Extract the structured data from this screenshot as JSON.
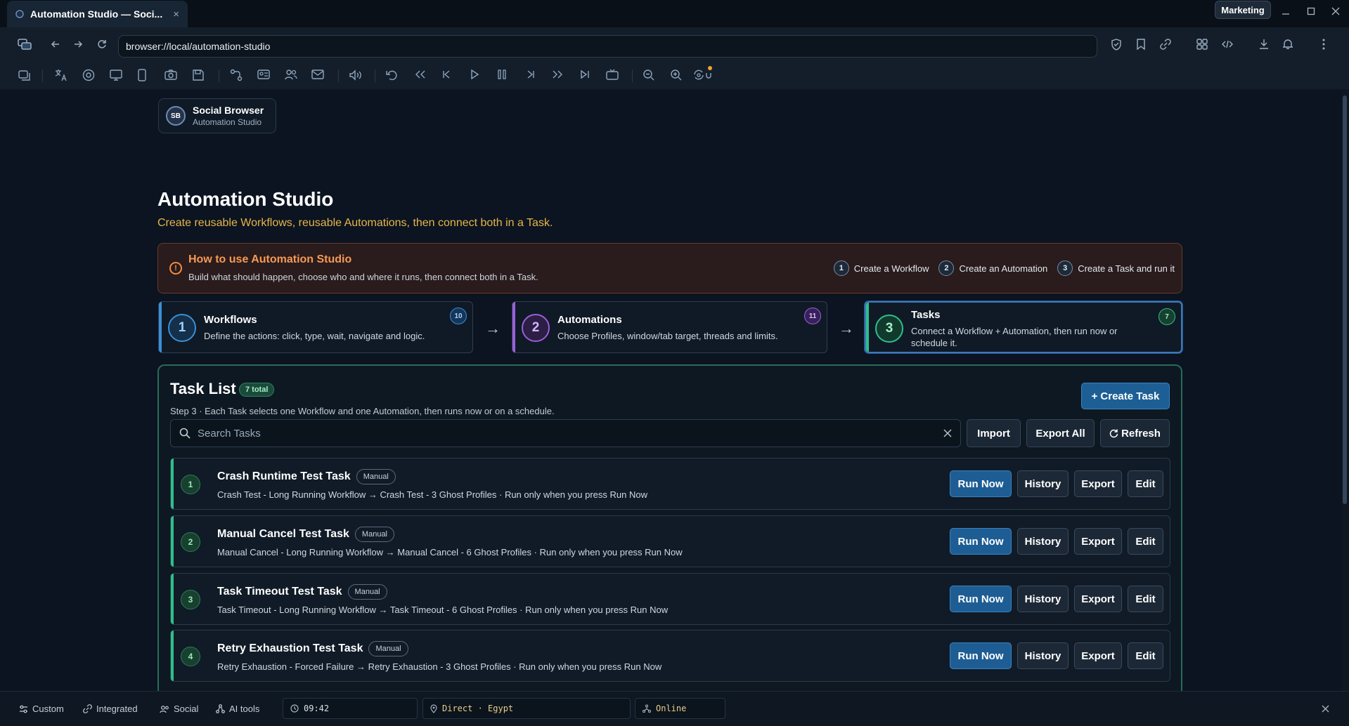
{
  "tab": {
    "title": "Automation Studio — Soci...",
    "close": "×"
  },
  "window": {
    "profile": "Marketing"
  },
  "navbar": {
    "url": "browser://local/automation-studio"
  },
  "brand": {
    "logo": "SB",
    "name": "Social Browser",
    "sub": "Automation Studio"
  },
  "header": {
    "title": "Automation Studio",
    "subtitle": "Create reusable Workflows, reusable Automations, then connect both in a Task."
  },
  "howto": {
    "title": "How to use Automation Studio",
    "desc": "Build what should happen, choose who and where it runs, then connect both in a Task.",
    "steps": [
      {
        "num": "1",
        "label": "Create a Workflow"
      },
      {
        "num": "2",
        "label": "Create an Automation"
      },
      {
        "num": "3",
        "label": "Create a Task and run it"
      }
    ]
  },
  "cards": [
    {
      "num": "1",
      "title": "Workflows",
      "desc": "Define the actions: click, type, wait, navigate and logic.",
      "badge": "10",
      "color": "#3a8fd6"
    },
    {
      "num": "2",
      "title": "Automations",
      "desc": "Choose Profiles, window/tab target, threads and limits.",
      "badge": "11",
      "color": "#9a5fd8"
    },
    {
      "num": "3",
      "title": "Tasks",
      "desc": "Connect a Workflow + Automation, then run now or schedule it.",
      "badge": "7",
      "color": "#2fbf8a"
    }
  ],
  "arrows": [
    "→",
    "→"
  ],
  "tasklist": {
    "title": "Task List",
    "badge": "7 total",
    "desc": "Step 3 · Each Task selects one Workflow and one Automation, then runs now or on a schedule.",
    "create": "Create Task",
    "search_placeholder": "Search Tasks",
    "import": "Import",
    "export_all": "Export All",
    "refresh": "Refresh",
    "rows": [
      {
        "num": "1",
        "title": "Crash Runtime Test Task",
        "mode": "Manual",
        "desc": "Crash Test - Long Running Workflow → Crash Test - 3 Ghost Profiles · Run only when you press Run Now"
      },
      {
        "num": "2",
        "title": "Manual Cancel Test Task",
        "mode": "Manual",
        "desc": "Manual Cancel - Long Running Workflow → Manual Cancel - 6 Ghost Profiles · Run only when you press Run Now"
      },
      {
        "num": "3",
        "title": "Task Timeout Test Task",
        "mode": "Manual",
        "desc": "Task Timeout - Long Running Workflow → Task Timeout - 6 Ghost Profiles · Run only when you press Run Now"
      },
      {
        "num": "4",
        "title": "Retry Exhaustion Test Task",
        "mode": "Manual",
        "desc": "Retry Exhaustion - Forced Failure → Retry Exhaustion - 3 Ghost Profiles · Run only when you press Run Now"
      }
    ],
    "row_buttons": {
      "run": "Run Now",
      "history": "History",
      "export": "Export",
      "edit": "Edit"
    }
  },
  "statusbar": {
    "custom": "Custom",
    "integrated": "Integrated",
    "social": "Social",
    "ai": "AI tools",
    "time": "09:42",
    "route": "Direct · Egypt",
    "status": "Online"
  }
}
